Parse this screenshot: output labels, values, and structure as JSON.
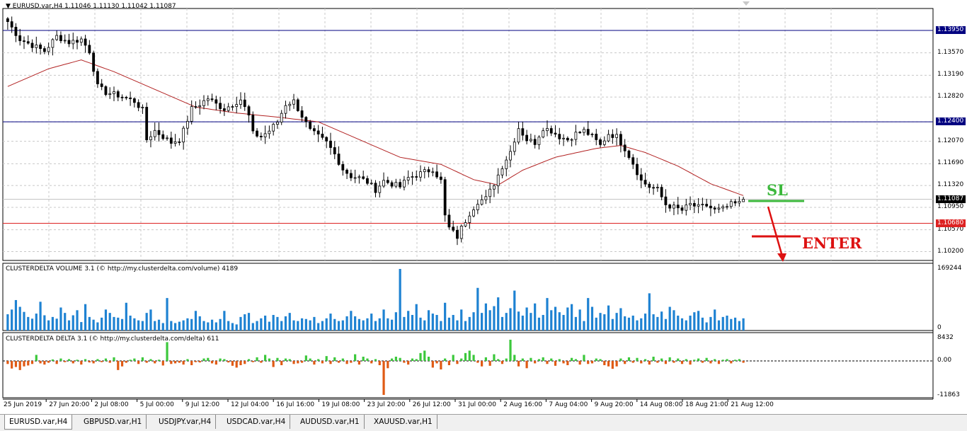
{
  "window": {
    "title": "EURUSD.var,H4  1.11046 1.11130 1.11042 1.11087"
  },
  "panes": {
    "volume_title": "CLUSTERDELTA VOLUME 3.1 (© http://my.clusterdelta.com/volume) 4189",
    "delta_title": "CLUSTERDELTA DELTA 3.1 (© http://my.clusterdelta.com/delta) 611"
  },
  "price_axis": [
    "1.13570",
    "1.13190",
    "1.12820",
    "1.12070",
    "1.11690",
    "1.11320",
    "1.10950",
    "1.10570",
    "1.10200"
  ],
  "price_badges": [
    {
      "label": "1.13950",
      "bg": "#000080",
      "fg": "#ffffff"
    },
    {
      "label": "1.12400",
      "bg": "#000080",
      "fg": "#ffffff"
    },
    {
      "label": "1.11087",
      "bg": "#000000",
      "fg": "#ffffff"
    },
    {
      "label": "1.10680",
      "bg": "#dd2222",
      "fg": "#ffffff"
    }
  ],
  "volume_axis": [
    "169244",
    "0"
  ],
  "delta_axis": [
    "8432",
    "0.00",
    "-11863"
  ],
  "time_axis": [
    "25 Jun 2019",
    "27 Jun 20:00",
    "2 Jul 08:00",
    "5 Jul 00:00",
    "9 Jul 12:00",
    "12 Jul 04:00",
    "16 Jul 16:00",
    "19 Jul 08:00",
    "23 Jul 20:00",
    "26 Jul 12:00",
    "31 Jul 00:00",
    "2 Aug 16:00",
    "7 Aug 04:00",
    "9 Aug 20:00",
    "14 Aug 08:00",
    "18 Aug 21:00",
    "21 Aug 12:00"
  ],
  "annotations": {
    "sl": "SL",
    "enter": "ENTER"
  },
  "tabs": [
    {
      "label": "EURUSD.var,H4",
      "active": true
    },
    {
      "label": "GBPUSD.var,H1",
      "active": false
    },
    {
      "label": "USDJPY.var,H4",
      "active": false
    },
    {
      "label": "USDCAD.var,H4",
      "active": false
    },
    {
      "label": "AUDUSD.var,H1",
      "active": false
    },
    {
      "label": "XAUUSD.var,H1",
      "active": false
    }
  ],
  "colors": {
    "candle": "#000000",
    "moving_average": "#b22222",
    "resistance_lines": "#000080",
    "entry_line": "#dd2222",
    "volume_bars": "#1e82d2",
    "delta_positive": "#3cc83c",
    "delta_negative": "#e05a14",
    "sl_color": "#3cb83c",
    "enter_color": "#dd1111",
    "grid": "#c8c8c8"
  },
  "chart_data": {
    "type": "candlestick",
    "symbol": "EURUSD.var",
    "timeframe": "H4",
    "ohlc_last": {
      "open": 1.11046,
      "high": 1.1113,
      "low": 1.11042,
      "close": 1.11087
    },
    "ylim": [
      1.1005,
      1.1425
    ],
    "horizontal_levels": [
      1.1395,
      1.124,
      1.1068
    ],
    "close_path": [
      [
        0,
        1.141
      ],
      [
        3,
        1.138
      ],
      [
        6,
        1.137
      ],
      [
        9,
        1.136
      ],
      [
        12,
        1.1385
      ],
      [
        15,
        1.1375
      ],
      [
        18,
        1.138
      ],
      [
        20,
        1.136
      ],
      [
        21,
        1.133
      ],
      [
        22,
        1.13
      ],
      [
        24,
        1.129
      ],
      [
        27,
        1.1285
      ],
      [
        29,
        1.128
      ],
      [
        31,
        1.1275
      ],
      [
        33,
        1.126
      ],
      [
        34,
        1.121
      ],
      [
        36,
        1.1225
      ],
      [
        38,
        1.1215
      ],
      [
        40,
        1.1205
      ],
      [
        42,
        1.121
      ],
      [
        43,
        1.1225
      ],
      [
        45,
        1.1262
      ],
      [
        47,
        1.127
      ],
      [
        49,
        1.128
      ],
      [
        51,
        1.127
      ],
      [
        53,
        1.1262
      ],
      [
        55,
        1.127
      ],
      [
        57,
        1.1278
      ],
      [
        59,
        1.125
      ],
      [
        60,
        1.122
      ],
      [
        62,
        1.1215
      ],
      [
        64,
        1.1225
      ],
      [
        66,
        1.124
      ],
      [
        68,
        1.127
      ],
      [
        70,
        1.1275
      ],
      [
        72,
        1.125
      ],
      [
        74,
        1.1225
      ],
      [
        76,
        1.1215
      ],
      [
        78,
        1.1205
      ],
      [
        80,
        1.1185
      ],
      [
        82,
        1.116
      ],
      [
        84,
        1.1148
      ],
      [
        86,
        1.1145
      ],
      [
        88,
        1.1138
      ],
      [
        90,
        1.1125
      ],
      [
        92,
        1.114
      ],
      [
        94,
        1.1135
      ],
      [
        96,
        1.113
      ],
      [
        98,
        1.1145
      ],
      [
        100,
        1.115
      ],
      [
        102,
        1.1155
      ],
      [
        104,
        1.116
      ],
      [
        106,
        1.114
      ],
      [
        107,
        1.108
      ],
      [
        108,
        1.106
      ],
      [
        110,
        1.1045
      ],
      [
        111,
        1.106
      ],
      [
        113,
        1.1085
      ],
      [
        115,
        1.1105
      ],
      [
        117,
        1.111
      ],
      [
        119,
        1.1135
      ],
      [
        121,
        1.1165
      ],
      [
        123,
        1.119
      ],
      [
        125,
        1.123
      ],
      [
        127,
        1.121
      ],
      [
        129,
        1.1205
      ],
      [
        131,
        1.123
      ],
      [
        133,
        1.1225
      ],
      [
        135,
        1.1215
      ],
      [
        137,
        1.121
      ],
      [
        139,
        1.122
      ],
      [
        141,
        1.1225
      ],
      [
        143,
        1.1215
      ],
      [
        145,
        1.12
      ],
      [
        147,
        1.122
      ],
      [
        149,
        1.1215
      ],
      [
        151,
        1.1195
      ],
      [
        153,
        1.117
      ],
      [
        155,
        1.114
      ],
      [
        157,
        1.113
      ],
      [
        159,
        1.1125
      ],
      [
        161,
        1.11
      ],
      [
        163,
        1.1095
      ],
      [
        165,
        1.109
      ],
      [
        167,
        1.11
      ],
      [
        169,
        1.1095
      ],
      [
        171,
        1.1098
      ],
      [
        173,
        1.109
      ],
      [
        175,
        1.1092
      ],
      [
        177,
        1.11
      ],
      [
        179,
        1.1102
      ],
      [
        180,
        1.11087
      ]
    ],
    "ma_path": [
      [
        0,
        1.13
      ],
      [
        10,
        1.133
      ],
      [
        18,
        1.1345
      ],
      [
        26,
        1.1325
      ],
      [
        36,
        1.1295
      ],
      [
        46,
        1.1265
      ],
      [
        56,
        1.1255
      ],
      [
        66,
        1.1248
      ],
      [
        76,
        1.124
      ],
      [
        86,
        1.121
      ],
      [
        96,
        1.118
      ],
      [
        106,
        1.1168
      ],
      [
        114,
        1.1142
      ],
      [
        120,
        1.1133
      ],
      [
        126,
        1.1158
      ],
      [
        134,
        1.118
      ],
      [
        144,
        1.1195
      ],
      [
        150,
        1.12
      ],
      [
        156,
        1.1188
      ],
      [
        164,
        1.1165
      ],
      [
        172,
        1.1135
      ],
      [
        180,
        1.1115
      ]
    ],
    "volume": {
      "ymax": 169244,
      "values": [
        48,
        62,
        90,
        70,
        55,
        40,
        35,
        50,
        85,
        45,
        30,
        40,
        35,
        68,
        52,
        30,
        45,
        60,
        25,
        78,
        40,
        32,
        24,
        38,
        62,
        52,
        40,
        38,
        34,
        82,
        44,
        36,
        30,
        28,
        52,
        62,
        28,
        32,
        22,
        96,
        28,
        22,
        26,
        30,
        36,
        34,
        58,
        42,
        28,
        24,
        32,
        24,
        34,
        58,
        28,
        22,
        18,
        40,
        48,
        52,
        22,
        28,
        36,
        44,
        26,
        46,
        40,
        28,
        42,
        52,
        30,
        28,
        36,
        34,
        30,
        40,
        22,
        28,
        36,
        50,
        34,
        28,
        30,
        42,
        58,
        42,
        34,
        30,
        36,
        50,
        28,
        36,
        62,
        36,
        32,
        54,
        182,
        40,
        58,
        46,
        78,
        38,
        30,
        60,
        50,
        46,
        28,
        82,
        38,
        46,
        30,
        62,
        28,
        40,
        54,
        126,
        52,
        80,
        60,
        72,
        98,
        40,
        52,
        66,
        118,
        56,
        44,
        68,
        52,
        80,
        38,
        46,
        96,
        60,
        70,
        54,
        46,
        68,
        78,
        40,
        62,
        28,
        96,
        70,
        38,
        52,
        48,
        74,
        34,
        52,
        66,
        42,
        38,
        44,
        30,
        36,
        50,
        110,
        48,
        40,
        56,
        34,
        70,
        60,
        44,
        36,
        30,
        44,
        54,
        58,
        38,
        24,
        40,
        62,
        30,
        40,
        44,
        34,
        38,
        28,
        36
      ]
    },
    "delta": {
      "ymax": 8432,
      "ymin": -11863,
      "values": [
        -10,
        -25,
        -20,
        -30,
        -18,
        -15,
        -10,
        20,
        -8,
        -12,
        -6,
        5,
        -10,
        8,
        -4,
        6,
        -8,
        4,
        -12,
        6,
        -5,
        -8,
        6,
        -4,
        8,
        -6,
        12,
        -30,
        -18,
        -6,
        4,
        8,
        -10,
        12,
        -6,
        6,
        -8,
        4,
        -15,
        62,
        -10,
        -8,
        -6,
        -12,
        6,
        -14,
        -4,
        -5,
        8,
        10,
        -8,
        -12,
        8,
        6,
        -5,
        -16,
        -22,
        -14,
        -10,
        6,
        -4,
        12,
        -6,
        20,
        8,
        -20,
        10,
        -14,
        8,
        6,
        -10,
        -8,
        -6,
        18,
        8,
        -12,
        6,
        -8,
        16,
        -10,
        12,
        -6,
        8,
        -10,
        -6,
        22,
        -12,
        14,
        8,
        -8,
        6,
        -14,
        -112,
        -24,
        8,
        14,
        10,
        -6,
        -12,
        8,
        6,
        26,
        34,
        14,
        -22,
        -8,
        -28,
        8,
        -14,
        20,
        -10,
        8,
        26,
        34,
        20,
        -6,
        -18,
        12,
        -16,
        22,
        6,
        -10,
        8,
        70,
        20,
        -18,
        8,
        -24,
        10,
        -8,
        6,
        12,
        -10,
        8,
        -16,
        6,
        -8,
        -14,
        10,
        6,
        -12,
        20,
        -10,
        -8,
        8,
        6,
        -14,
        -18,
        -26,
        -18,
        8,
        -10,
        12,
        -6,
        10,
        -8,
        6,
        -12,
        14,
        -6,
        8,
        -10,
        12,
        -6,
        8,
        -10,
        6,
        -12,
        4,
        8,
        -6,
        10,
        -8,
        6,
        -10,
        4,
        6,
        -8,
        4,
        6,
        -6
      ]
    }
  }
}
